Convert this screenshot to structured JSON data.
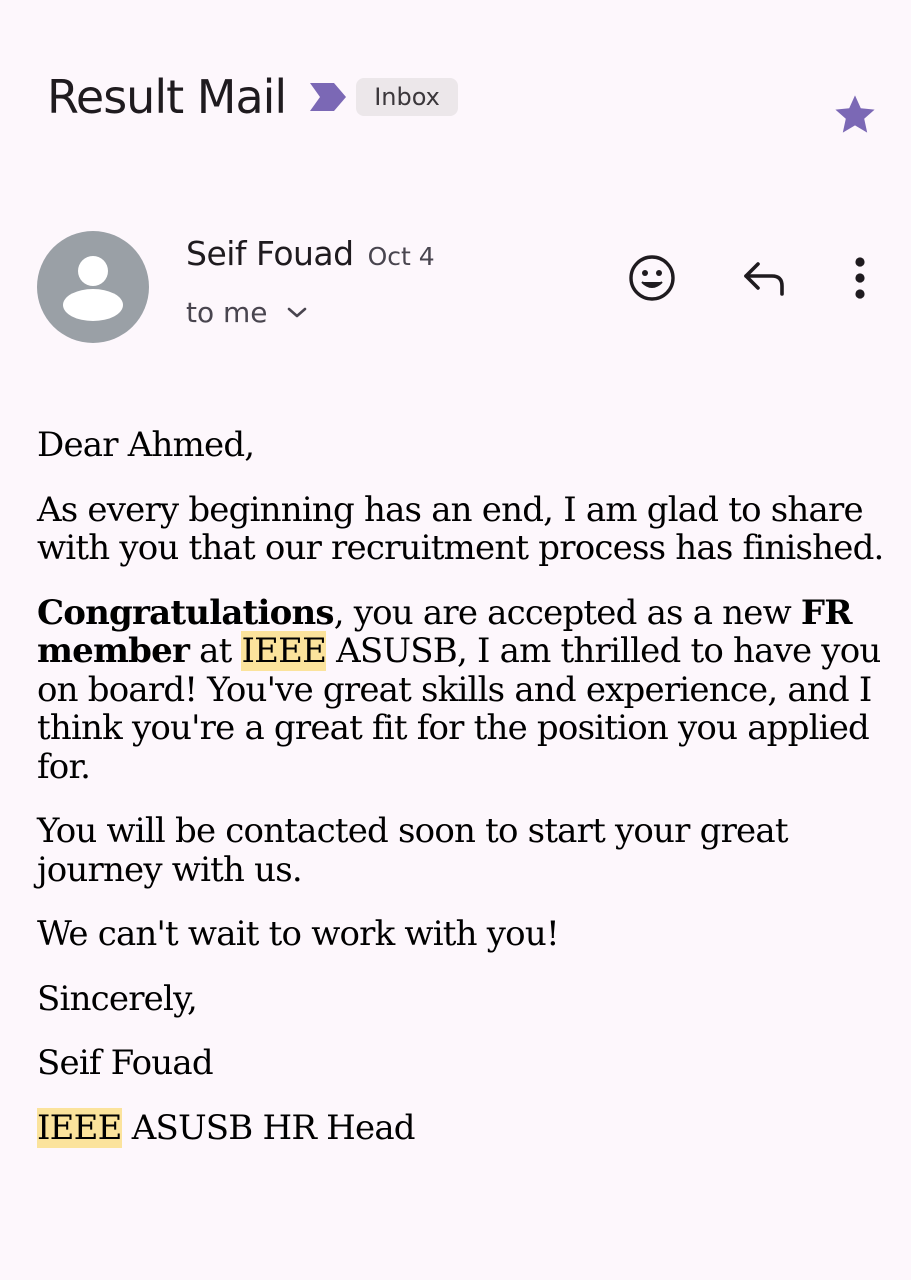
{
  "header": {
    "subject": "Result Mail",
    "label": "Inbox",
    "importance_color": "#7b68b5",
    "star_color": "#7b68b5",
    "starred": true
  },
  "message": {
    "sender_name": "Seif Fouad",
    "date": "Oct 4",
    "recipient": "to me",
    "avatar_icon": "person-icon",
    "actions": [
      "emoji-reaction-icon",
      "reply-icon",
      "more-options-icon"
    ]
  },
  "body": {
    "greeting": "Dear Ahmed,",
    "p1": "As every beginning has an end, I am glad to share with you that our recruitment process has finished.",
    "p2_bold1": "Congratulations",
    "p2_text1": ", you are accepted as a new ",
    "p2_bold2": "FR member",
    "p2_text2": " at ",
    "p2_highlight": "IEEE",
    "p2_text3": " ASUSB, I am thrilled to have you on board! You've great skills and experience, and I think you're a great fit for the position you applied for.",
    "p3": "You will be contacted soon to start your great journey with us.",
    "p4": "We can't wait to work with you!",
    "closing": "Sincerely,",
    "signature_name": "Seif Fouad",
    "signature_org_highlight": "IEEE",
    "signature_title": " ASUSB HR Head",
    "highlight_color": "#fbe39c"
  }
}
